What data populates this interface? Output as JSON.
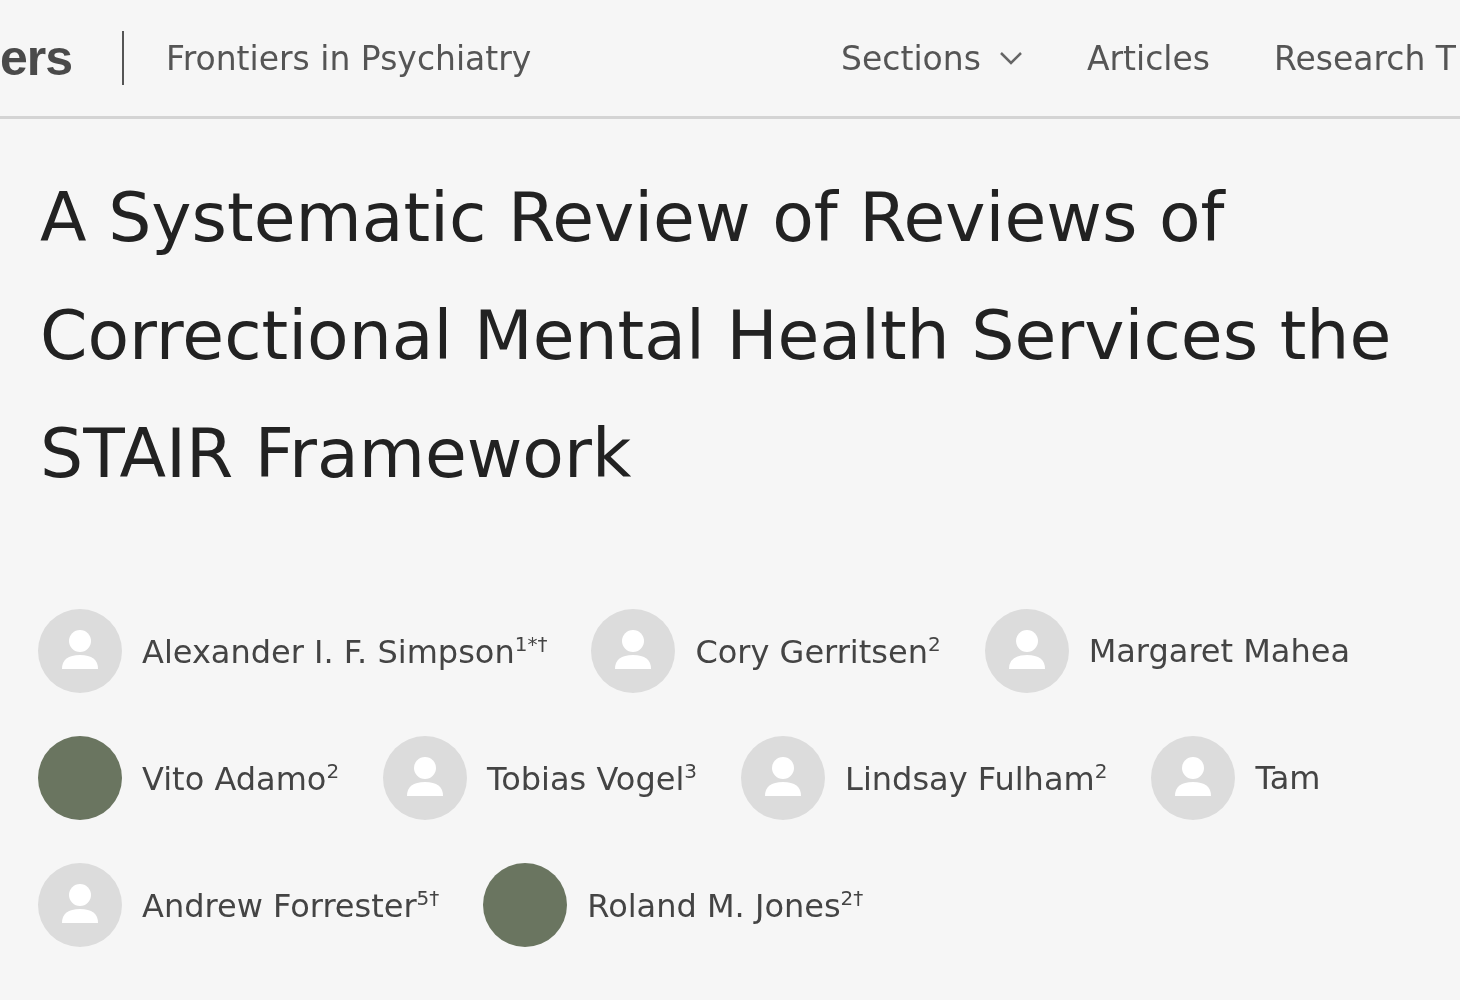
{
  "header": {
    "logo": "ers",
    "journal": "Frontiers in Psychiatry",
    "nav": [
      {
        "label": "Sections",
        "dropdown": true
      },
      {
        "label": "Articles",
        "dropdown": false
      },
      {
        "label": "Research T",
        "dropdown": false
      }
    ]
  },
  "title": "A Systematic Review of Reviews of Correctional Mental Health Services the STAIR Framework",
  "author_rows": [
    [
      {
        "name": "Alexander I. F. Simpson$^{1*†}$",
        "kind": "placeholder"
      },
      {
        "name": "Cory Gerritsen$^{2}$",
        "kind": "placeholder"
      },
      {
        "name": "Margaret Mahea",
        "kind": "placeholder"
      }
    ],
    [
      {
        "name": "Vito Adamo$^{2}$",
        "kind": "photo"
      },
      {
        "name": "Tobias Vogel$^{3}$",
        "kind": "placeholder"
      },
      {
        "name": "Lindsay Fulham$^{2}$",
        "kind": "placeholder"
      },
      {
        "name": "Tam",
        "kind": "placeholder"
      }
    ],
    [
      {
        "name": "Andrew Forrester$^{5†}$",
        "kind": "placeholder"
      },
      {
        "name": "Roland M. Jones$^{2†}$",
        "kind": "photo"
      }
    ]
  ]
}
